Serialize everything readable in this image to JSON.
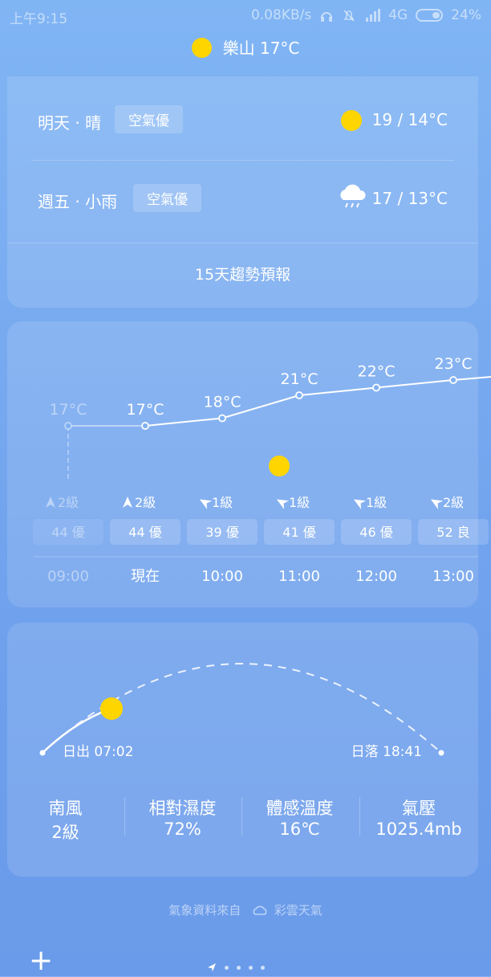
{
  "status_bar": {
    "time": "上午9:15",
    "net_speed": "0.08KB/s",
    "network": "4G",
    "battery": "24%"
  },
  "location": {
    "city": "樂山",
    "temp": "17°C"
  },
  "daily": [
    {
      "label": "明天 · 晴",
      "aqi": "空氣優",
      "temp": "19 / 14°C",
      "icon": "sun-icon"
    },
    {
      "label": "週五 · 小雨",
      "aqi": "空氣優",
      "temp": "17 / 13°C",
      "icon": "rain-cloud-icon"
    }
  ],
  "trend_15": "15天趨勢預報",
  "hourly": {
    "temps": [
      "17°C",
      "17°C",
      "18°C",
      "21°C",
      "22°C",
      "23°C"
    ],
    "temp_values": [
      17,
      17,
      18,
      21,
      22,
      23
    ],
    "winds": [
      "2級",
      "2級",
      "1級",
      "1級",
      "1級",
      "2級"
    ],
    "aqi": [
      "44 優",
      "44 優",
      "39 優",
      "41 優",
      "46 優",
      "52 良"
    ],
    "times": [
      "09:00",
      "現在",
      "10:00",
      "11:00",
      "12:00",
      "13:00"
    ]
  },
  "sun": {
    "sunrise": "日出 07:02",
    "sunset": "日落 18:41",
    "day_progress": 0.07
  },
  "metrics": [
    {
      "label": "南風",
      "value": "2級"
    },
    {
      "label": "相對濕度",
      "value": "72%"
    },
    {
      "label": "體感溫度",
      "value": "16℃"
    },
    {
      "label": "氣壓",
      "value": "1025.4mb"
    }
  ],
  "source": {
    "prefix": "氣象資料來自",
    "provider": "彩雲天氣"
  },
  "colors": {
    "sun": "#ffd500",
    "background": "#78aaf0"
  }
}
